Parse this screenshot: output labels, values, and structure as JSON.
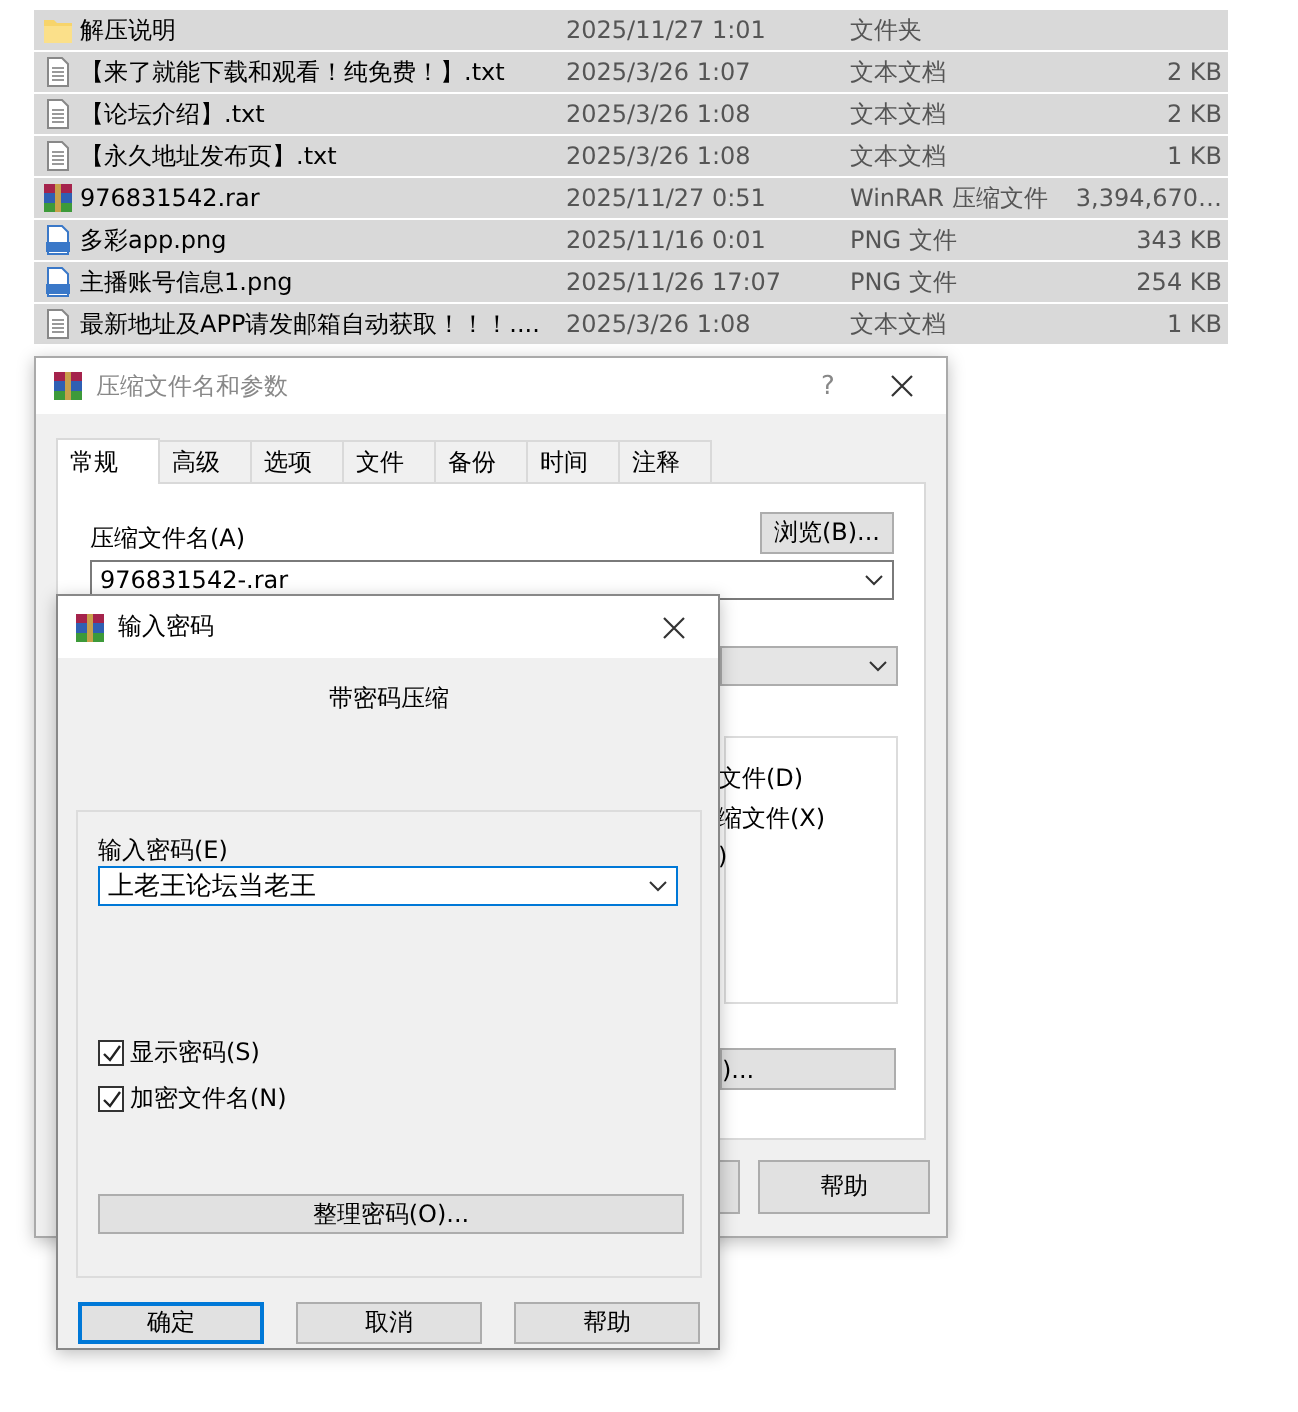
{
  "files": [
    {
      "kind": "folder",
      "name": "解压说明",
      "date": "2025/11/27 1:01",
      "type": "文件夹"
    },
    {
      "kind": "text",
      "name": "【来了就能下载和观看！纯免费！】.txt",
      "date": "2025/3/26 1:07",
      "type": "文本文档",
      "size": "2 KB"
    },
    {
      "kind": "text",
      "name": "【论坛介绍】.txt",
      "date": "2025/3/26 1:08",
      "type": "文本文档",
      "size": "2 KB"
    },
    {
      "kind": "text",
      "name": "【永久地址发布页】.txt",
      "date": "2025/3/26 1:08",
      "type": "文本文档",
      "size": "1 KB"
    },
    {
      "kind": "rar",
      "name": "976831542.rar",
      "date": "2025/11/27 0:51",
      "type": "WinRAR 压缩文件",
      "size": "3,394,670…"
    },
    {
      "kind": "png",
      "name": "多彩app.png",
      "date": "2025/11/16 0:01",
      "type": "PNG 文件",
      "size": "343 KB"
    },
    {
      "kind": "png",
      "name": "主播账号信息1.png",
      "date": "2025/11/26 17:07",
      "type": "PNG 文件",
      "size": "254 KB"
    },
    {
      "kind": "text",
      "name": "最新地址及APP请发邮箱自动获取！！！....",
      "date": "2025/3/26 1:08",
      "type": "文本文档",
      "size": "1 KB"
    }
  ],
  "archive_dialog": {
    "title": "压缩文件名和参数",
    "help_glyph": "?",
    "tabs": [
      {
        "label": "常规",
        "selected": true
      },
      {
        "label": "高级",
        "selected": false
      },
      {
        "label": "选项",
        "selected": false
      },
      {
        "label": "文件",
        "selected": false
      },
      {
        "label": "备份",
        "selected": false
      },
      {
        "label": "时间",
        "selected": false
      },
      {
        "label": "注释",
        "selected": false
      }
    ],
    "archive_name_label": "压缩文件名(A)",
    "browse_button": "浏览(B)...",
    "archive_name": "976831542-.rar",
    "options": [
      "文件(D)",
      "缩文件(X)",
      ")"
    ],
    "partial_button": ")...",
    "help_button": "帮助"
  },
  "password_dialog": {
    "title": "输入密码",
    "heading": "带密码压缩",
    "field_label": "输入密码(E)",
    "password": "上老王论坛当老王",
    "checkboxes": [
      {
        "label": "显示密码(S)",
        "checked": true
      },
      {
        "label": "加密文件名(N)",
        "checked": true
      }
    ],
    "organize_button": "整理密码(O)...",
    "buttons": [
      {
        "label": "确定",
        "default": true
      },
      {
        "label": "取消",
        "default": false
      },
      {
        "label": "帮助",
        "default": false
      }
    ]
  }
}
